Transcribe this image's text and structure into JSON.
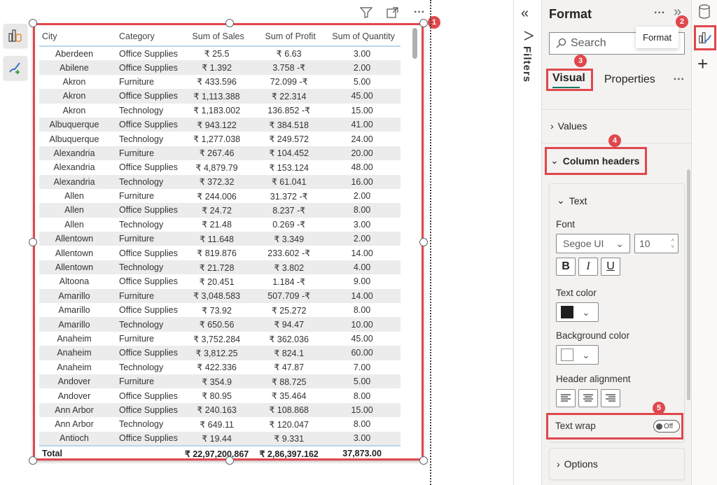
{
  "visual_header": {
    "icons": [
      "filter-icon",
      "focus-mode-icon",
      "more-options-icon"
    ]
  },
  "left_toolbar": {
    "icons": [
      "build-visual-icon",
      "format-visual-icon"
    ]
  },
  "table": {
    "headers": [
      "City",
      "Category",
      "Sum of Sales",
      "Sum of Profit",
      "Sum of Quantity"
    ],
    "rows": [
      [
        "Aberdeen",
        "Office Supplies",
        "₹ 25.5",
        "₹ 6.63",
        "3.00"
      ],
      [
        "Abilene",
        "Office Supplies",
        "₹ 1.392",
        "3.758 -₹",
        "2.00"
      ],
      [
        "Akron",
        "Furniture",
        "₹ 433.596",
        "72.099 -₹",
        "5.00"
      ],
      [
        "Akron",
        "Office Supplies",
        "₹ 1,113.388",
        "₹ 22.314",
        "45.00"
      ],
      [
        "Akron",
        "Technology",
        "₹ 1,183.002",
        "136.852 -₹",
        "15.00"
      ],
      [
        "Albuquerque",
        "Office Supplies",
        "₹ 943.122",
        "₹ 384.518",
        "41.00"
      ],
      [
        "Albuquerque",
        "Technology",
        "₹ 1,277.038",
        "₹ 249.572",
        "24.00"
      ],
      [
        "Alexandria",
        "Furniture",
        "₹ 267.46",
        "₹ 104.452",
        "20.00"
      ],
      [
        "Alexandria",
        "Office Supplies",
        "₹ 4,879.79",
        "₹ 153.124",
        "48.00"
      ],
      [
        "Alexandria",
        "Technology",
        "₹ 372.32",
        "₹ 61.041",
        "16.00"
      ],
      [
        "Allen",
        "Furniture",
        "₹ 244.006",
        "31.372 -₹",
        "2.00"
      ],
      [
        "Allen",
        "Office Supplies",
        "₹ 24.72",
        "8.237 -₹",
        "8.00"
      ],
      [
        "Allen",
        "Technology",
        "₹ 21.48",
        "0.269 -₹",
        "3.00"
      ],
      [
        "Allentown",
        "Furniture",
        "₹ 11.648",
        "₹ 3.349",
        "2.00"
      ],
      [
        "Allentown",
        "Office Supplies",
        "₹ 819.876",
        "233.602 -₹",
        "14.00"
      ],
      [
        "Allentown",
        "Technology",
        "₹ 21.728",
        "₹ 3.802",
        "4.00"
      ],
      [
        "Altoona",
        "Office Supplies",
        "₹ 20.451",
        "1.184 -₹",
        "9.00"
      ],
      [
        "Amarillo",
        "Furniture",
        "₹ 3,048.583",
        "507.709 -₹",
        "14.00"
      ],
      [
        "Amarillo",
        "Office Supplies",
        "₹ 73.92",
        "₹ 25.272",
        "8.00"
      ],
      [
        "Amarillo",
        "Technology",
        "₹ 650.56",
        "₹ 94.47",
        "10.00"
      ],
      [
        "Anaheim",
        "Furniture",
        "₹ 3,752.284",
        "₹ 362.036",
        "45.00"
      ],
      [
        "Anaheim",
        "Office Supplies",
        "₹ 3,812.25",
        "₹ 824.1",
        "60.00"
      ],
      [
        "Anaheim",
        "Technology",
        "₹ 422.336",
        "₹ 47.87",
        "7.00"
      ],
      [
        "Andover",
        "Furniture",
        "₹ 354.9",
        "₹ 88.725",
        "5.00"
      ],
      [
        "Andover",
        "Office Supplies",
        "₹ 80.95",
        "₹ 35.464",
        "8.00"
      ],
      [
        "Ann Arbor",
        "Office Supplies",
        "₹ 240.163",
        "₹ 108.868",
        "15.00"
      ],
      [
        "Ann Arbor",
        "Technology",
        "₹ 649.11",
        "₹ 120.047",
        "8.00"
      ],
      [
        "Antioch",
        "Office Supplies",
        "₹ 19.44",
        "₹ 9.331",
        "3.00"
      ]
    ],
    "total": {
      "label": "Total",
      "sales": "₹ 22,97,200.867",
      "profit": "₹ 2,86,397.162",
      "quantity": "37,873.00"
    }
  },
  "badges": [
    "1",
    "2",
    "3",
    "4",
    "5"
  ],
  "filters_pane": {
    "label": "Filters",
    "collapse_icon": "«"
  },
  "format_pane": {
    "title": "Format",
    "more": "···",
    "expand_icon": "»",
    "search_placeholder": "Search",
    "tooltip": "Format",
    "tabs": [
      "Visual",
      "Properties"
    ],
    "tabs_more": "···",
    "sections": {
      "values": "Values",
      "column_headers": "Column headers",
      "options": "Options"
    },
    "text_card": {
      "title": "Text",
      "font_label": "Font",
      "font_family": "Segoe UI",
      "font_size": "10",
      "bold": "B",
      "italic": "I",
      "underline": "U",
      "text_color_label": "Text color",
      "text_color": "#1f1f1f",
      "background_color_label": "Background color",
      "background_color": "#ffffff",
      "header_alignment_label": "Header alignment",
      "text_wrap_label": "Text wrap",
      "text_wrap_state": "Off"
    }
  },
  "accent_colors": {
    "highlight": "#e0474c",
    "tab_underline": "#117865",
    "header_rule": "#b9d5ee"
  }
}
